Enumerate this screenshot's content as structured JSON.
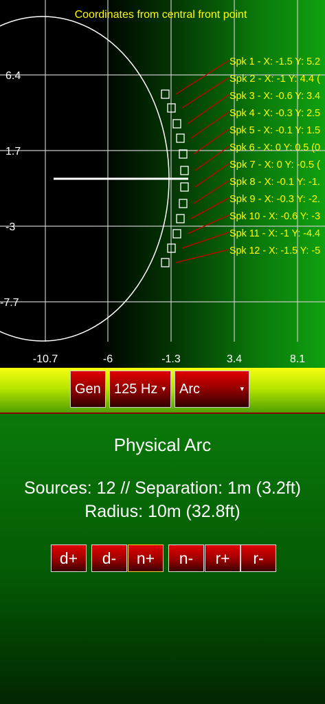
{
  "plot": {
    "title": "Coordinates from central front point",
    "x_ticks": [
      "-10.7",
      "-6",
      "-1.3",
      "3.4",
      "8.1"
    ],
    "y_ticks": [
      "6.4",
      "1.7",
      "-3",
      "-7.7"
    ],
    "speakers": [
      "Spk 1 - X: -1.5 Y: 5.2",
      "Spk 2 - X: -1 Y: 4.4 (",
      "Spk 3 - X: -0.6 Y: 3.4",
      "Spk 4 - X: -0.3 Y: 2.5",
      "Spk 5 - X: -0.1 Y: 1.5",
      "Spk 6 - X: 0 Y: 0.5 (0",
      "Spk 7 - X: 0 Y: -0.5 (",
      "Spk 8 - X: -0.1 Y: -1.",
      "Spk 9 - X: -0.3 Y: -2.",
      "Spk 10 - X: -0.6 Y: -3",
      "Spk 11 - X: -1 Y: -4.4",
      "Spk 12 - X: -1.5 Y: -5"
    ],
    "colors": {
      "grid": "#c8c8c8",
      "label": "#ffff00",
      "leader": "#cc0000",
      "arc": "#ffffff"
    }
  },
  "toolbar": {
    "gen_label": "Gen",
    "freq_label": "125 Hz",
    "mode_label": "Arc",
    "dropdown_arrow": "▾"
  },
  "panel": {
    "title": "Physical Arc",
    "line1": "Sources: 12 // Separation: 1m (3.2ft)",
    "line2": "Radius: 10m (32.8ft)",
    "buttons": [
      "d+",
      "d-",
      "n+",
      "n-",
      "r+",
      "r-"
    ],
    "active_button": "n+"
  }
}
